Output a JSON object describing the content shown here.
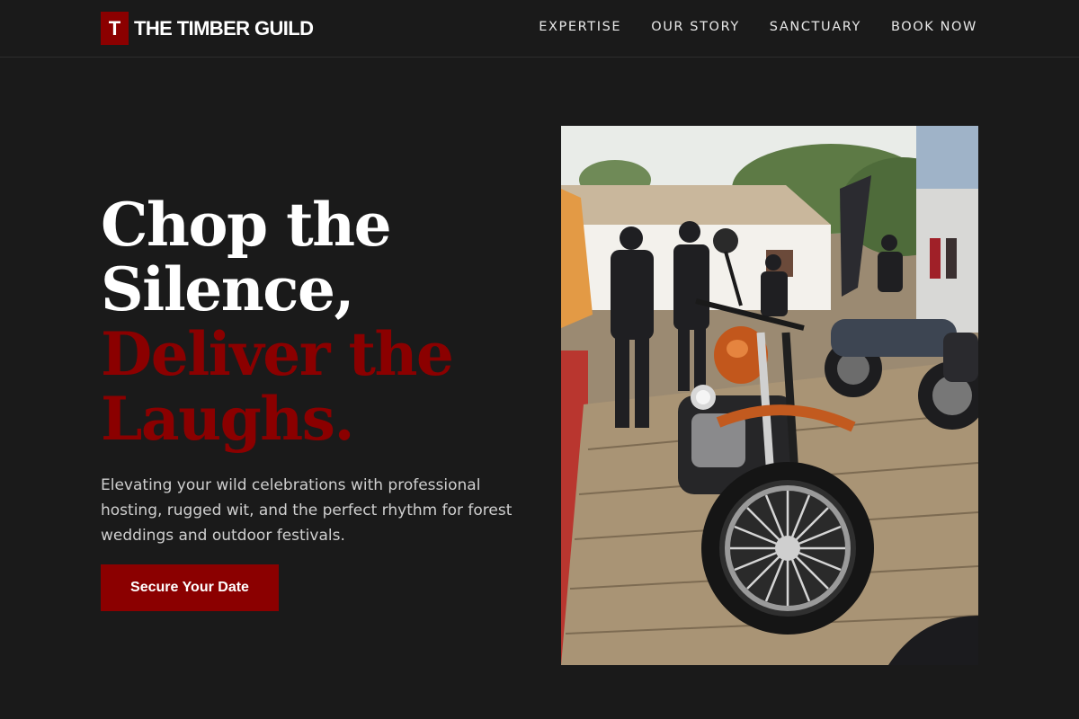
{
  "brand": {
    "mark": "T",
    "name": "THE TIMBER GUILD",
    "accent_color": "#8b0000"
  },
  "nav": {
    "items": [
      {
        "label": "EXPERTISE"
      },
      {
        "label": "OUR STORY"
      },
      {
        "label": "SANCTUARY"
      },
      {
        "label": "BOOK NOW"
      }
    ]
  },
  "hero": {
    "title_line1": "Chop the Silence,",
    "title_line2": "Deliver the Laughs.",
    "subtitle": "Elevating your wild celebrations with professional hosting, rugged wit, and the perfect rhythm for forest weddings and outdoor festivals.",
    "cta_label": "Secure Your Date"
  },
  "image": {
    "alt": "Motorcycles displayed on a wooden deck at an outdoor event"
  }
}
